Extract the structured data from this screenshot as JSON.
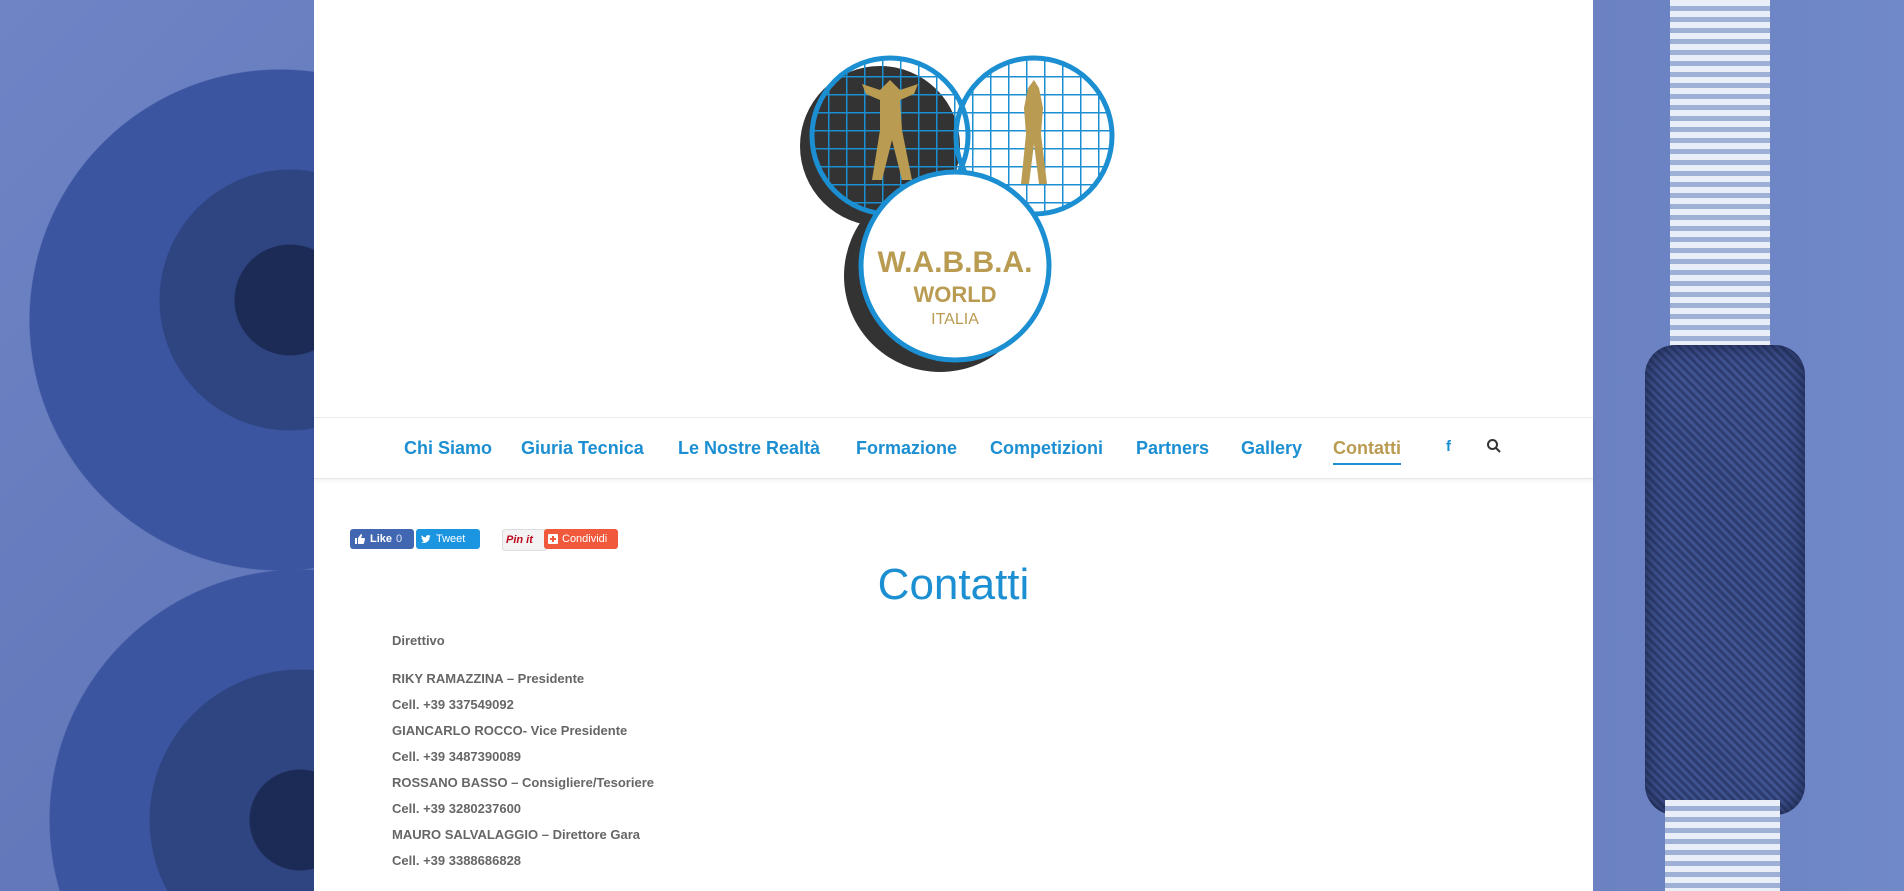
{
  "logo": {
    "line1": "W.A.B.B.A.",
    "line2": "WORLD",
    "line3": "ITALIA"
  },
  "nav": {
    "items": [
      {
        "label": "Chi Siamo"
      },
      {
        "label": "Giuria Tecnica"
      },
      {
        "label": "Le Nostre Realtà"
      },
      {
        "label": "Formazione"
      },
      {
        "label": "Competizioni"
      },
      {
        "label": "Partners"
      },
      {
        "label": "Gallery"
      },
      {
        "label": "Contatti"
      }
    ],
    "facebook_glyph": "f",
    "search_glyph": "⌕"
  },
  "social": {
    "like_label": "Like",
    "like_count": "0",
    "tweet_label": "Tweet",
    "pin_label": "Pin it",
    "share_label": "Condividi"
  },
  "page": {
    "title": "Contatti",
    "section": "Direttivo",
    "lines": [
      "RIKY RAMAZZINA – Presidente",
      "Cell. +39 337549092",
      "GIANCARLO ROCCO- Vice Presidente",
      "Cell. +39 3487390089",
      "ROSSANO BASSO – Consigliere/Tesoriere",
      "Cell. +39 3280237600",
      "MAURO SALVALAGGIO – Direttore Gara",
      "Cell. +39 3388686828"
    ]
  },
  "colors": {
    "accent": "#1b8fd2",
    "active": "#b99b52"
  }
}
